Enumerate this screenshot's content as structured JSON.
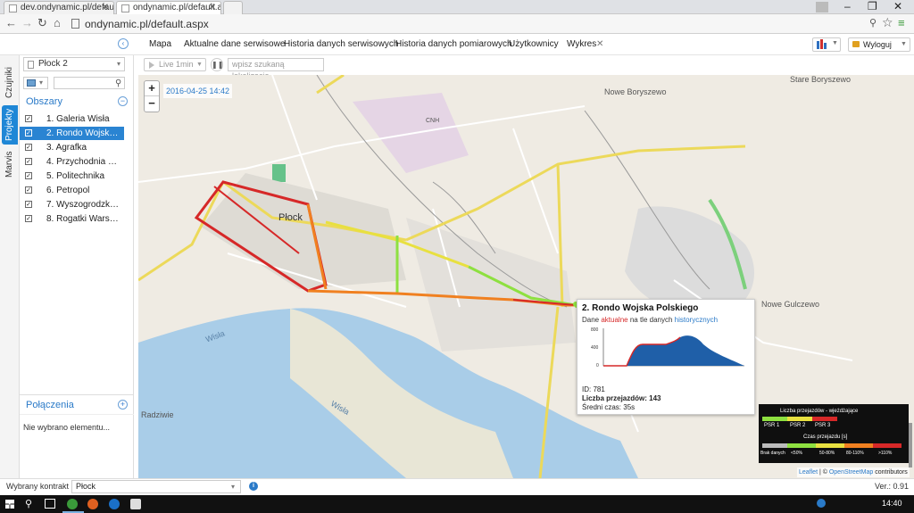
{
  "browser": {
    "tabs": [
      {
        "title": "dev.ondynamic.pl/default..."
      },
      {
        "title": "ondynamic.pl/default.aspx"
      }
    ],
    "address": "ondynamic.pl/default.aspx"
  },
  "menu": {
    "items": [
      "Mapa",
      "Aktualne dane serwisowe",
      "Historia danych serwisowych",
      "Historia danych pomiarowych",
      "Użytkownicy",
      "Wykres"
    ],
    "logout": "Wyloguj"
  },
  "vtabs": [
    "Czujniki",
    "Projekty",
    "Marvis"
  ],
  "sidebar": {
    "city": "Płock 2",
    "areas_header": "Obszary",
    "areas": [
      "1. Galeria Wisła",
      "2. Rondo Wojska P...",
      "3. Agrafka",
      "4. Przychodnia Gry...",
      "5. Politechnika",
      "6. Petropol",
      "7. Wyszogrodzka 40",
      "8. Rogatki Warszaw..."
    ],
    "connections_header": "Połączenia",
    "no_selection": "Nie wybrano elementu..."
  },
  "maptools": {
    "live": "Live 1min",
    "search_placeholder": "wpisz szukaną lokalizację"
  },
  "map": {
    "timestamp": "2016-04-25 14:42",
    "zoom_in": "+",
    "zoom_out": "−",
    "labels": {
      "city": "Płock",
      "n_boryszewo": "Nowe Boryszewo",
      "s_boryszewo": "Stare Boryszewo",
      "n_gulczewo": "Nowe Gulczewo",
      "radziwie": "Radziwie",
      "cnh": "CNH",
      "wisla1": "Wisła",
      "wisla2": "Wisła"
    },
    "popup": {
      "title": "2. Rondo Wojska Polskiego",
      "subtitle_pre": "Dane ",
      "subtitle_current": "aktualne",
      "subtitle_mid": " na tle danych ",
      "subtitle_hist": "historycznych",
      "id": "ID: 781",
      "count": "Liczba przejazdów: 143",
      "avg": "Średni czas: 35s",
      "y_ticks": [
        "800",
        "400",
        "0"
      ]
    },
    "legend": {
      "title1": "Liczba przejazdów - wjeżdżające",
      "psr": [
        "PSR 1",
        "PSR 2",
        "PSR 3"
      ],
      "title2": "Czas przejazdu [s]",
      "time": [
        "Brak danych",
        "<50%",
        "50-80%",
        "80-110%",
        ">110%"
      ]
    },
    "attribution": {
      "leaflet": "Leaflet",
      "sep": " | © ",
      "osm": "OpenStreetMap",
      "rest": " contributors"
    },
    "colors": {
      "red": "#d62828",
      "orange": "#f08020",
      "yellow": "#e8e040",
      "green": "#8ee040"
    }
  },
  "bottombar": {
    "contract_label": "Wybrany kontrakt",
    "contract_value": "Płock",
    "version": "Ver.: 0.91"
  },
  "taskbar": {
    "time": "14:40"
  }
}
